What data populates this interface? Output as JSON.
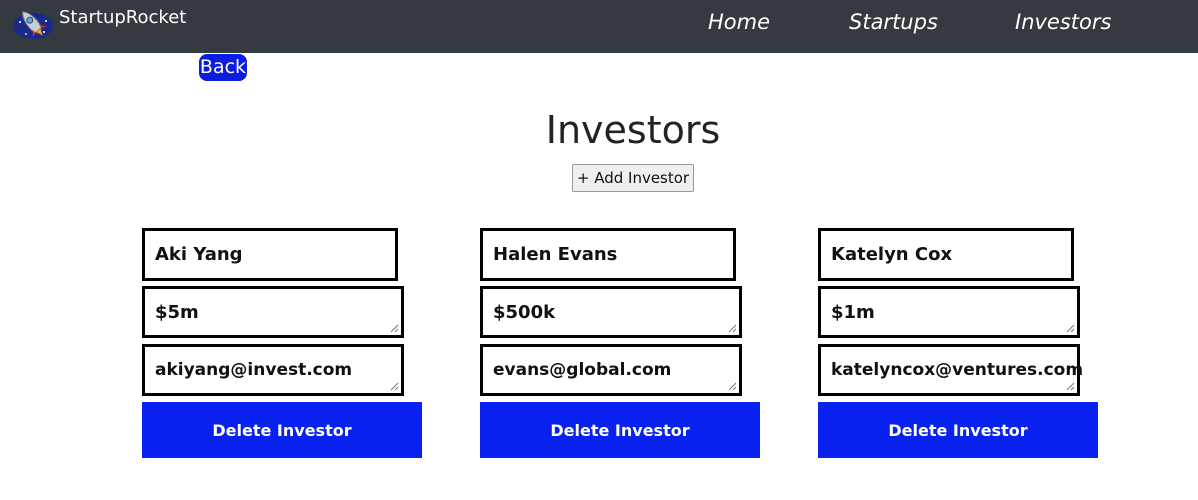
{
  "app": {
    "brand": "StartupRocket",
    "logo_icon": "rocket-logo"
  },
  "nav": {
    "items": [
      {
        "label": "Home"
      },
      {
        "label": "Startups"
      },
      {
        "label": "Investors"
      }
    ]
  },
  "page": {
    "back_label": "Back",
    "title": "Investors",
    "add_label": "+ Add Investor",
    "delete_label": "Delete Investor"
  },
  "investors": [
    {
      "name": "Aki Yang",
      "amount": "$5m",
      "email": "akiyang@invest.com"
    },
    {
      "name": "Halen Evans",
      "amount": "$500k",
      "email": "evans@global.com"
    },
    {
      "name": "Katelyn Cox",
      "amount": "$1m",
      "email": "katelyncox@ventures.com"
    }
  ],
  "colors": {
    "navbar": "#343a40",
    "accent": "#0a22f0"
  }
}
